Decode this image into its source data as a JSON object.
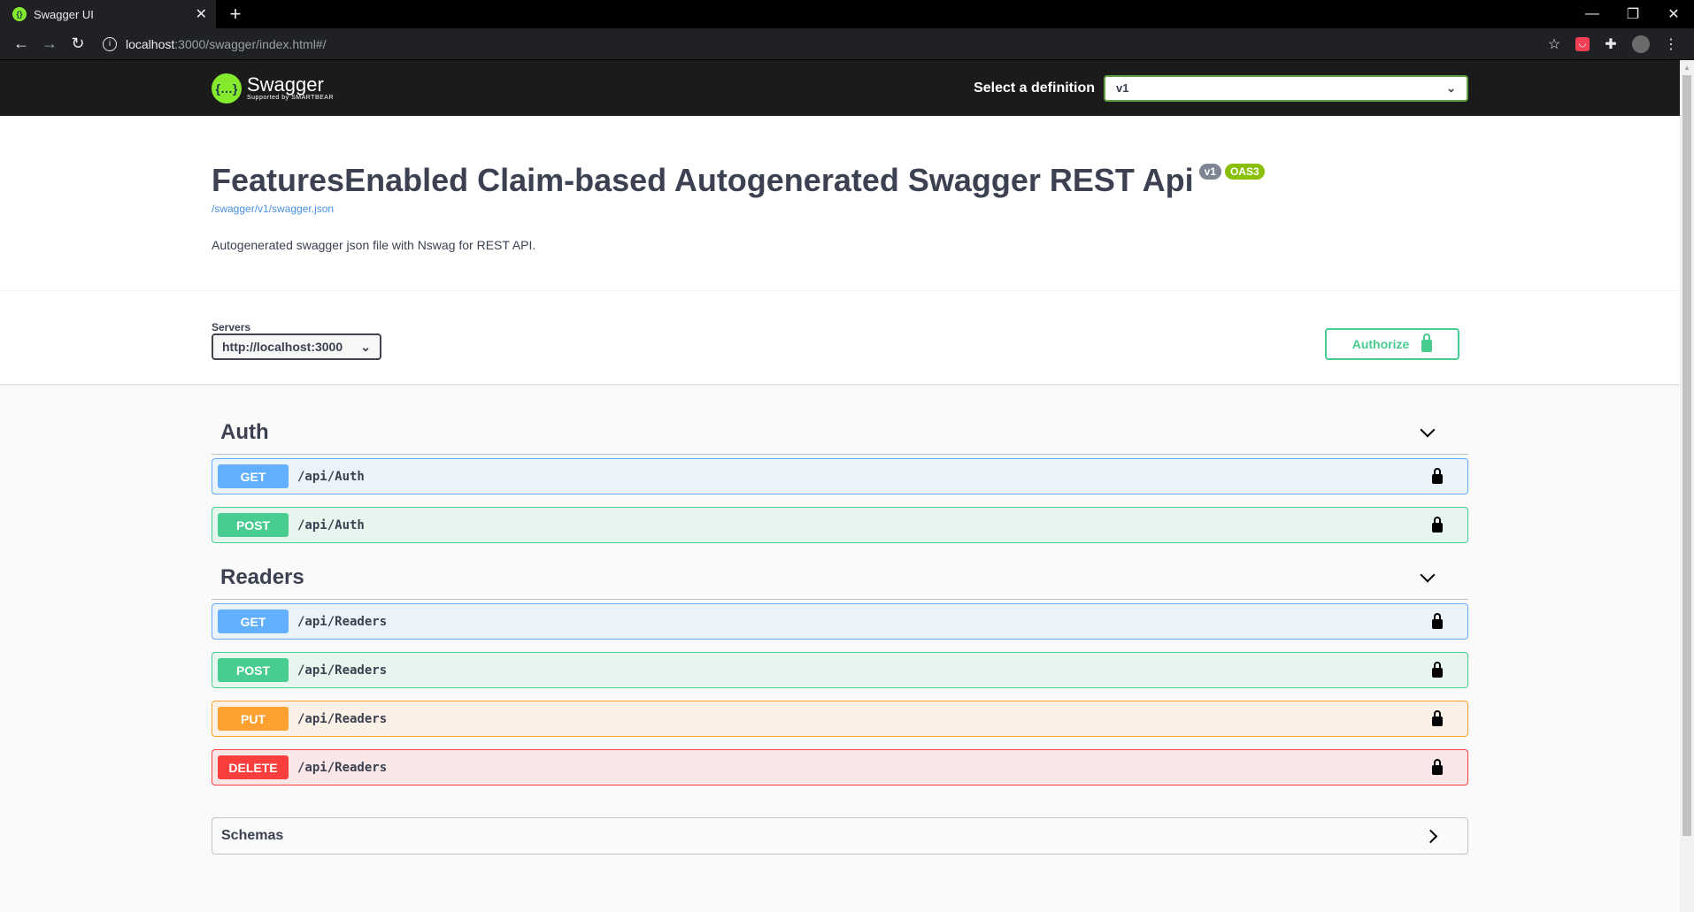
{
  "browser": {
    "tab_title": "Swagger UI",
    "url_host": "localhost",
    "url_path": ":3000/swagger/index.html#/"
  },
  "header": {
    "logo_name": "Swagger",
    "logo_sub": "Supported by SMARTBEAR",
    "select_label": "Select a definition",
    "select_value": "v1"
  },
  "info": {
    "title": "FeaturesEnabled Claim-based Autogenerated Swagger REST Api",
    "version_badge": "v1",
    "oas_badge": "OAS3",
    "spec_url": "/swagger/v1/swagger.json",
    "description": "Autogenerated swagger json file with Nswag for REST API."
  },
  "schemes": {
    "servers_label": "Servers",
    "servers_value": "http://localhost:3000",
    "authorize_label": "Authorize"
  },
  "tags": [
    {
      "name": "Auth",
      "operations": [
        {
          "method": "GET",
          "path": "/api/Auth"
        },
        {
          "method": "POST",
          "path": "/api/Auth"
        }
      ]
    },
    {
      "name": "Readers",
      "operations": [
        {
          "method": "GET",
          "path": "/api/Readers"
        },
        {
          "method": "POST",
          "path": "/api/Readers"
        },
        {
          "method": "PUT",
          "path": "/api/Readers"
        },
        {
          "method": "DELETE",
          "path": "/api/Readers"
        }
      ]
    }
  ],
  "schemas": {
    "label": "Schemas"
  },
  "colors": {
    "get": "#61affe",
    "post": "#49cc90",
    "put": "#fca130",
    "delete": "#f93e3e",
    "swagger_green": "#85ea2d"
  }
}
